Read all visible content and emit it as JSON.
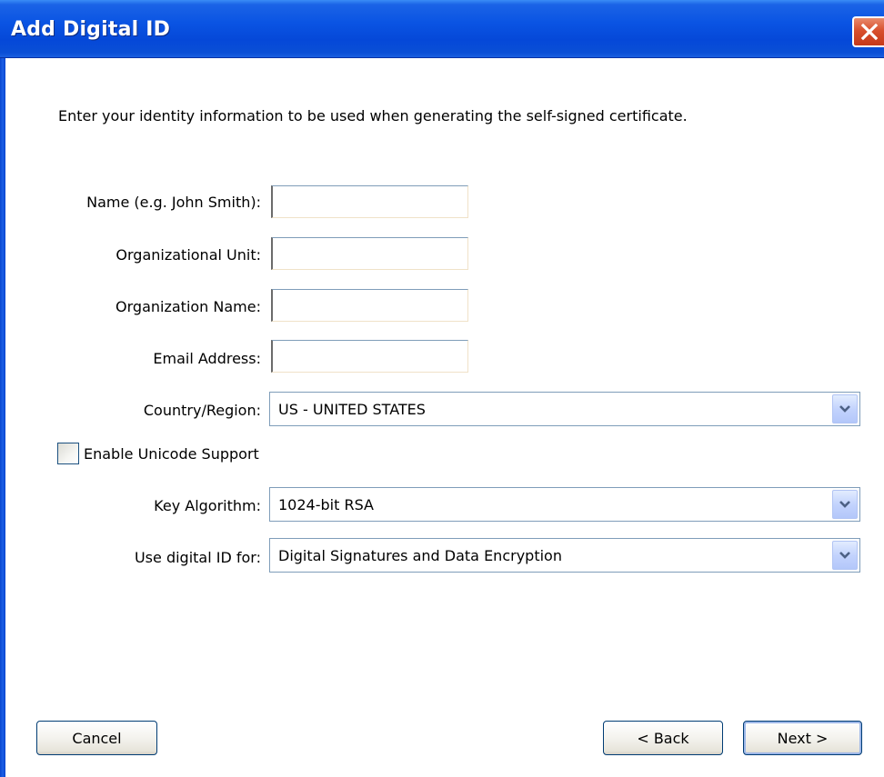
{
  "window": {
    "title": "Add Digital ID"
  },
  "intro_text": "Enter your identity information to be used when generating the self-signed certificate.",
  "form": {
    "name": {
      "label": "Name (e.g. John Smith):",
      "value": ""
    },
    "org_unit": {
      "label": "Organizational Unit:",
      "value": ""
    },
    "org_name": {
      "label": "Organization Name:",
      "value": ""
    },
    "email": {
      "label": "Email Address:",
      "value": ""
    },
    "country": {
      "label": "Country/Region:",
      "selected": "US - UNITED STATES"
    },
    "unicode": {
      "label": "Enable Unicode Support",
      "checked": false
    },
    "key_algorithm": {
      "label": "Key Algorithm:",
      "selected": "1024-bit RSA"
    },
    "use_for": {
      "label": "Use digital ID for:",
      "selected": "Digital Signatures and Data Encryption"
    }
  },
  "buttons": {
    "cancel": "Cancel",
    "back": "< Back",
    "next": "Next >"
  },
  "icons": {
    "close": "close-icon",
    "dropdown": "chevron-down-icon"
  },
  "colors": {
    "titlebar": "#0548d8",
    "close_button": "#d8502d",
    "dropdown_arrow_bg": "#c3d3fd",
    "dropdown_arrow_fg": "#4d6185"
  }
}
